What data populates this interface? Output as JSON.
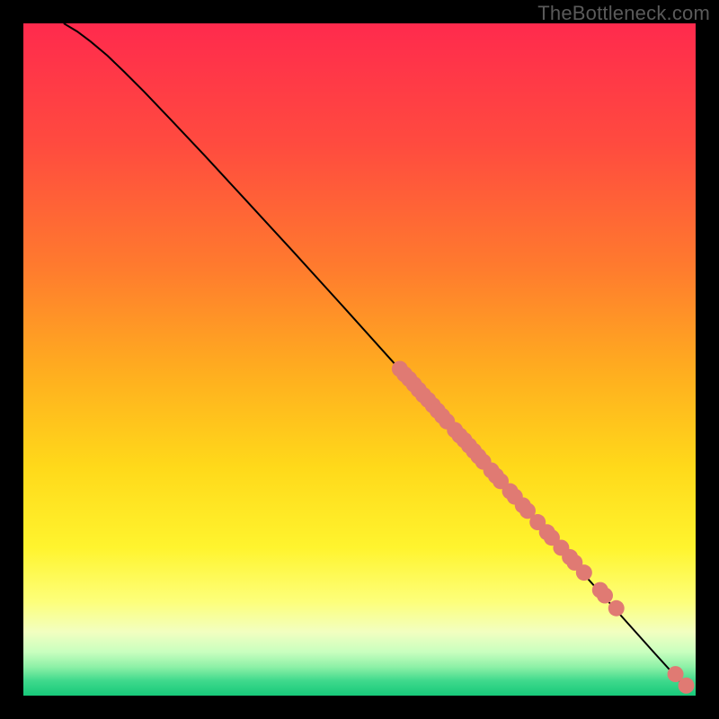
{
  "watermark": "TheBottleneck.com",
  "chart_data": {
    "type": "line",
    "title": "",
    "xlabel": "",
    "ylabel": "",
    "xlim": [
      0,
      100
    ],
    "ylim": [
      0,
      100
    ],
    "grid": false,
    "legend": false,
    "background_gradient": {
      "stops": [
        {
          "offset": 0.0,
          "color": "#ff2a4d"
        },
        {
          "offset": 0.18,
          "color": "#ff4b3f"
        },
        {
          "offset": 0.36,
          "color": "#ff7a2e"
        },
        {
          "offset": 0.52,
          "color": "#ffae1f"
        },
        {
          "offset": 0.66,
          "color": "#ffd91a"
        },
        {
          "offset": 0.78,
          "color": "#fff42e"
        },
        {
          "offset": 0.86,
          "color": "#fdff7a"
        },
        {
          "offset": 0.905,
          "color": "#f2ffc0"
        },
        {
          "offset": 0.935,
          "color": "#c9ffbf"
        },
        {
          "offset": 0.958,
          "color": "#8bf0a6"
        },
        {
          "offset": 0.978,
          "color": "#3fd98c"
        },
        {
          "offset": 1.0,
          "color": "#17c97a"
        }
      ]
    },
    "curve": [
      {
        "x": 6.0,
        "y": 100.0
      },
      {
        "x": 8.0,
        "y": 98.8
      },
      {
        "x": 10.0,
        "y": 97.3
      },
      {
        "x": 12.5,
        "y": 95.2
      },
      {
        "x": 15.0,
        "y": 92.8
      },
      {
        "x": 18.0,
        "y": 89.8
      },
      {
        "x": 22.0,
        "y": 85.6
      },
      {
        "x": 27.0,
        "y": 80.3
      },
      {
        "x": 33.0,
        "y": 73.8
      },
      {
        "x": 40.0,
        "y": 66.2
      },
      {
        "x": 48.0,
        "y": 57.4
      },
      {
        "x": 56.0,
        "y": 48.5
      },
      {
        "x": 64.0,
        "y": 39.6
      },
      {
        "x": 72.0,
        "y": 30.7
      },
      {
        "x": 80.0,
        "y": 21.8
      },
      {
        "x": 88.0,
        "y": 12.9
      },
      {
        "x": 94.0,
        "y": 6.2
      },
      {
        "x": 99.0,
        "y": 0.7
      }
    ],
    "points": {
      "color": "#e07a73",
      "radius": 1.2,
      "data": [
        {
          "x": 56.0,
          "y": 48.6
        },
        {
          "x": 56.7,
          "y": 47.8
        },
        {
          "x": 57.4,
          "y": 47.1
        },
        {
          "x": 58.1,
          "y": 46.3
        },
        {
          "x": 58.8,
          "y": 45.5
        },
        {
          "x": 59.5,
          "y": 44.7
        },
        {
          "x": 60.2,
          "y": 44.0
        },
        {
          "x": 60.9,
          "y": 43.2
        },
        {
          "x": 61.6,
          "y": 42.4
        },
        {
          "x": 62.3,
          "y": 41.6
        },
        {
          "x": 63.0,
          "y": 40.8
        },
        {
          "x": 64.2,
          "y": 39.5
        },
        {
          "x": 64.9,
          "y": 38.7
        },
        {
          "x": 65.6,
          "y": 38.0
        },
        {
          "x": 66.3,
          "y": 37.2
        },
        {
          "x": 67.0,
          "y": 36.4
        },
        {
          "x": 67.7,
          "y": 35.6
        },
        {
          "x": 68.4,
          "y": 34.8
        },
        {
          "x": 69.6,
          "y": 33.5
        },
        {
          "x": 70.3,
          "y": 32.7
        },
        {
          "x": 71.0,
          "y": 31.9
        },
        {
          "x": 72.4,
          "y": 30.4
        },
        {
          "x": 73.1,
          "y": 29.6
        },
        {
          "x": 74.3,
          "y": 28.3
        },
        {
          "x": 75.0,
          "y": 27.5
        },
        {
          "x": 76.5,
          "y": 25.8
        },
        {
          "x": 77.9,
          "y": 24.3
        },
        {
          "x": 78.6,
          "y": 23.5
        },
        {
          "x": 80.0,
          "y": 22.0
        },
        {
          "x": 81.3,
          "y": 20.6
        },
        {
          "x": 82.0,
          "y": 19.8
        },
        {
          "x": 83.4,
          "y": 18.3
        },
        {
          "x": 85.8,
          "y": 15.7
        },
        {
          "x": 86.5,
          "y": 14.9
        },
        {
          "x": 88.2,
          "y": 13.0
        },
        {
          "x": 97.0,
          "y": 3.2
        },
        {
          "x": 98.6,
          "y": 1.5
        }
      ]
    }
  }
}
